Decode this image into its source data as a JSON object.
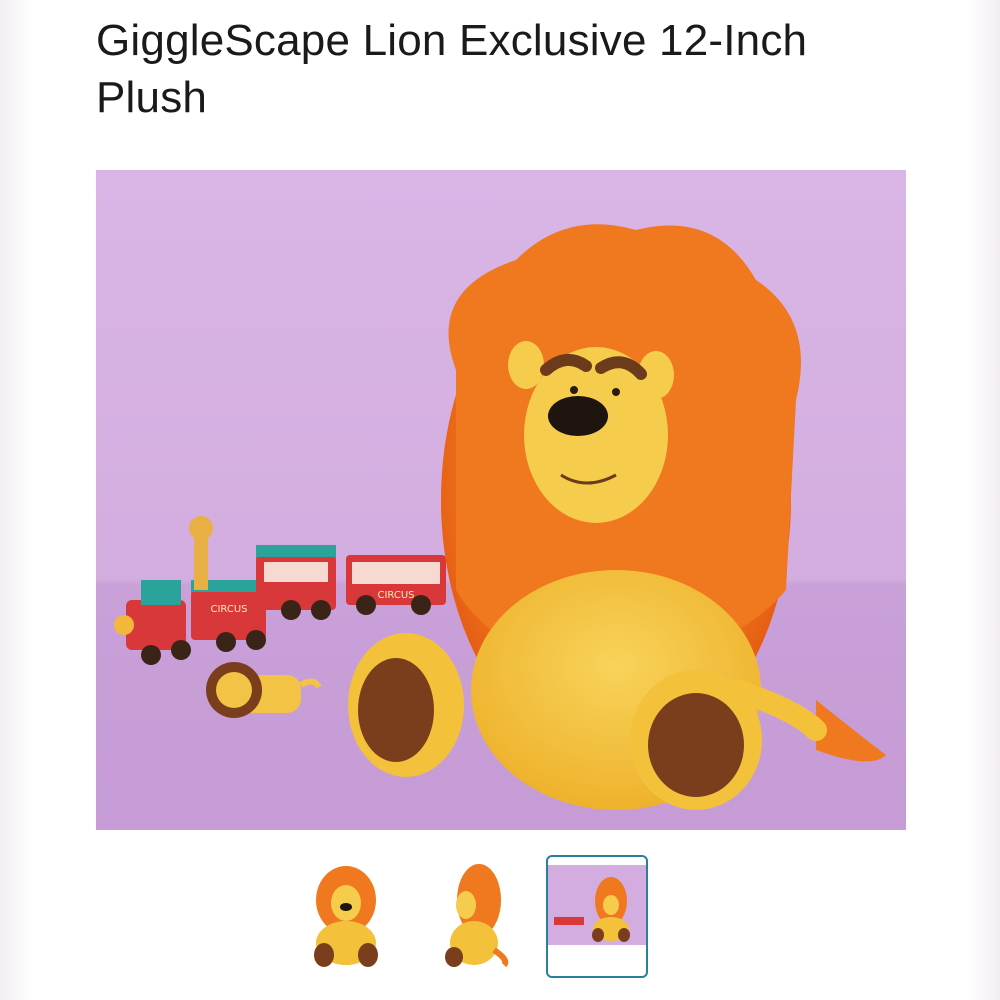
{
  "product": {
    "title": "GiggleScape Lion Exclusive 12-Inch Plush"
  },
  "gallery": {
    "selected_index": 2,
    "thumbnail_count": 3
  },
  "colors": {
    "background_purple": "#d7b3e3",
    "mane_orange": "#f0781e",
    "body_yellow": "#f3c23a",
    "paw_brown": "#7a3e1c",
    "selected_border": "#2a7f9e"
  },
  "toy_labels": {
    "train_car_text": "CIRCUS"
  }
}
